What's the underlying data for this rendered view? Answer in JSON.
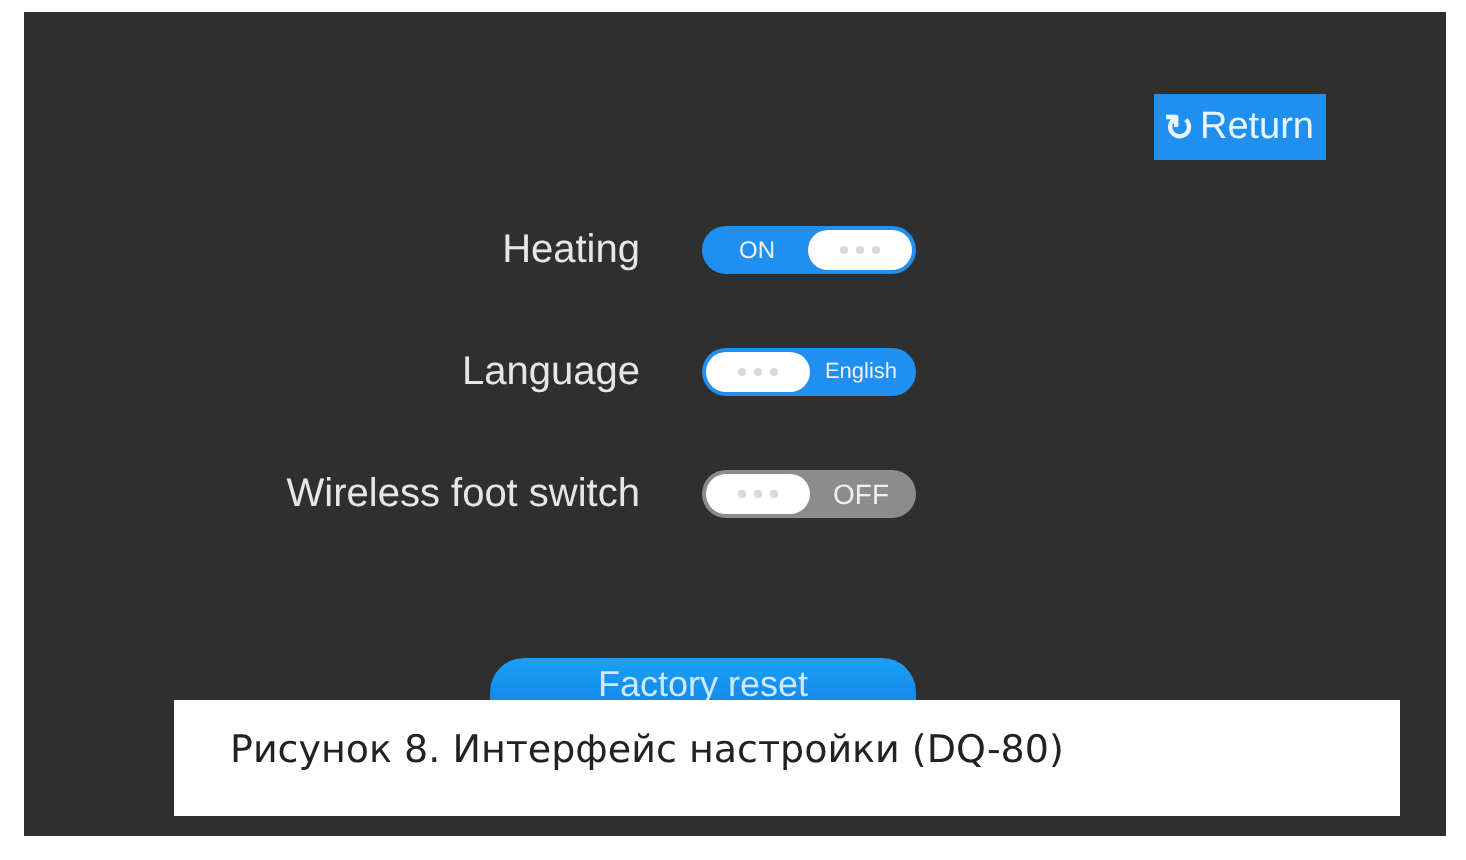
{
  "return_button": {
    "icon": "↻",
    "label": "Return"
  },
  "settings": [
    {
      "label": "Heating",
      "on": true,
      "thumb_right": true,
      "text": "ON"
    },
    {
      "label": "Language",
      "on": true,
      "thumb_right": false,
      "text": "English"
    },
    {
      "label": "Wireless foot switch",
      "on": false,
      "thumb_right": false,
      "text": "OFF"
    }
  ],
  "reset_button": {
    "label": "Factory reset"
  },
  "caption": "Рисунок 8. Интерфейс настройки (DQ-80)"
}
